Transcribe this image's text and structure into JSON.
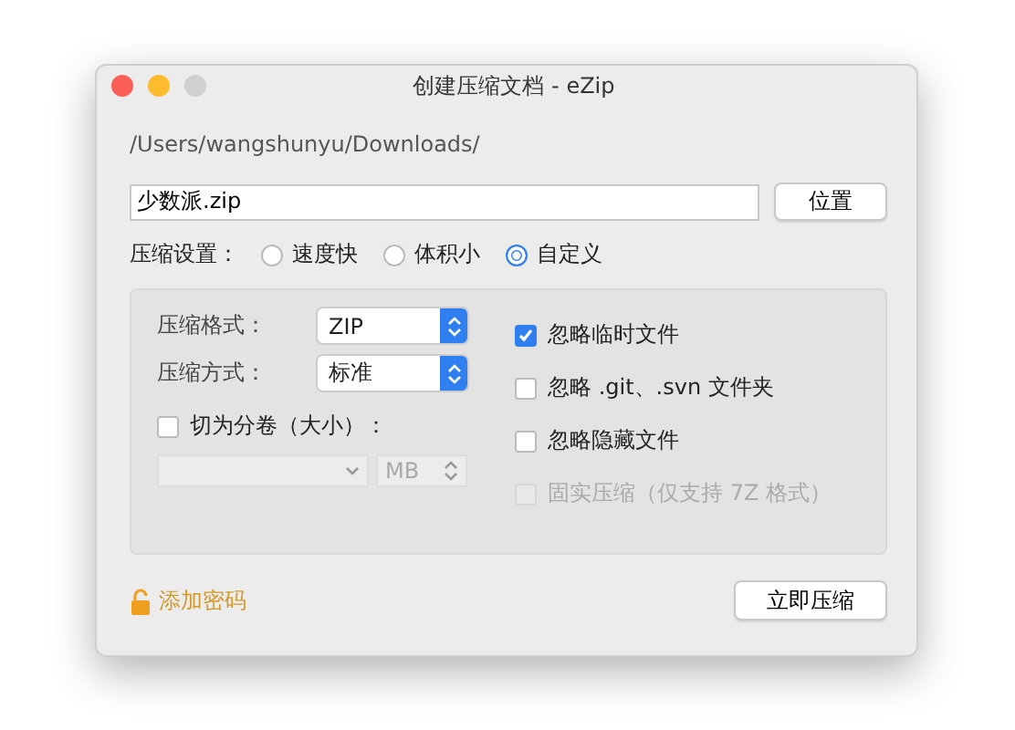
{
  "window": {
    "title": "创建压缩文档 - eZip"
  },
  "path": "/Users/wangshunyu/Downloads/",
  "filename": {
    "value": "少数派.zip"
  },
  "location_button": "位置",
  "compression_setting": {
    "label": "压缩设置：",
    "options": [
      {
        "label": "速度快",
        "selected": false
      },
      {
        "label": "体积小",
        "selected": false
      },
      {
        "label": "自定义",
        "selected": true
      }
    ]
  },
  "custom_panel": {
    "selects": [
      {
        "label": "压缩格式：",
        "value": "ZIP",
        "disabled": false
      },
      {
        "label": "压缩方式：",
        "value": "标准",
        "disabled": false
      }
    ],
    "split": {
      "label": "切为分卷（大小）：",
      "checked": false,
      "unit": "MB",
      "disabled": true
    },
    "options": [
      {
        "label": "忽略临时文件",
        "checked": true,
        "disabled": false
      },
      {
        "label": "忽略 .git、.svn 文件夹",
        "checked": false,
        "disabled": false
      },
      {
        "label": "忽略隐藏文件",
        "checked": false,
        "disabled": false
      },
      {
        "label": "固实压缩（仅支持 7Z 格式）",
        "checked": false,
        "disabled": true
      }
    ]
  },
  "password_link": "添加密码",
  "compress_button": "立即压缩"
}
